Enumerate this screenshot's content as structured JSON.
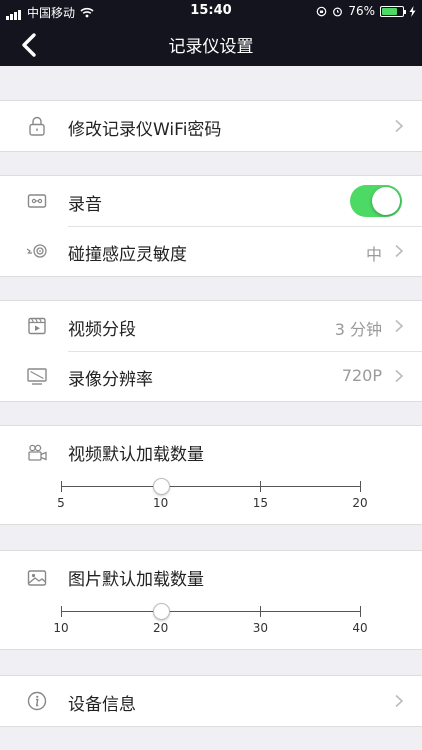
{
  "status_bar": {
    "carrier": "中国移动",
    "time": "15:40",
    "battery": "76%",
    "battery_level": 0.76
  },
  "nav": {
    "title": "记录仪设置"
  },
  "wifi_row": {
    "label": "修改记录仪WiFi密码"
  },
  "audio_row": {
    "label": "录音",
    "enabled": true
  },
  "collision_row": {
    "label": "碰撞感应灵敏度",
    "value": "中"
  },
  "segment_row": {
    "label": "视频分段",
    "value": "3 分钟"
  },
  "resolution_row": {
    "label": "录像分辨率",
    "value": "720P"
  },
  "video_load": {
    "label": "视频默认加载数量",
    "ticks": [
      "5",
      "10",
      "15",
      "20"
    ],
    "value_index": 1
  },
  "photo_load": {
    "label": "图片默认加载数量",
    "ticks": [
      "10",
      "20",
      "30",
      "40"
    ],
    "value_index": 1
  },
  "device_row": {
    "label": "设备信息"
  },
  "colors": {
    "header": "#14141e",
    "toggle_on": "#4cd964",
    "background": "#efeff4"
  }
}
